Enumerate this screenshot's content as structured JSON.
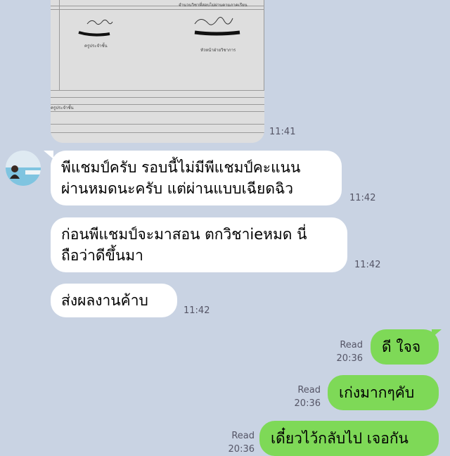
{
  "photo_message": {
    "time": "11:41",
    "doc_text": {
      "header_line": "จำนวนวิชาที่สอบไม่ผ่านตามภาคเรียน",
      "signer_left_title": "ครูประจำชั้น",
      "signer_right_title": "หัวหน้าฝ่ายวิชาการ",
      "bottom_label": "ครูประจำชั้น"
    }
  },
  "messages": [
    {
      "type": "in",
      "text": "พีแชมป์ครับ รอบนี้ไม่มีพีแชมป์คะแนน\nผ่านหมดนะครับ แต่ผ่านแบบเฉียดฉิว",
      "time": "11:42"
    },
    {
      "type": "in",
      "text": "ก่อนพีแชมป์จะมาสอน ตกวิชาieหมด นี่\nถือว่าดีขึ้นมา",
      "time": "11:42"
    },
    {
      "type": "in",
      "text": "ส่งผลงานค้าบ",
      "time": "11:42"
    },
    {
      "type": "out",
      "text": "ดี ใจจ",
      "read": "Read",
      "time": "20:36"
    },
    {
      "type": "out",
      "text": "เก่งมากๆคับ",
      "read": "Read",
      "time": "20:36"
    },
    {
      "type": "out",
      "text": "เดี๋ยวไว้กลับไป เจอกัน",
      "read": "Read",
      "time": "20:36"
    }
  ],
  "colors": {
    "background": "#c9d3e3",
    "incoming_bubble": "#ffffff",
    "outgoing_bubble": "#7ed957"
  },
  "avatar_icon": "profile-photo-avatar-icon"
}
